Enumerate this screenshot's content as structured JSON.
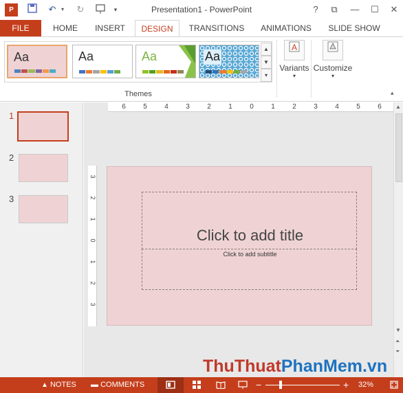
{
  "app": {
    "window_title": "Presentation1 - PowerPoint",
    "accent": "#c43e1c",
    "window_buttons": {
      "help": "?",
      "restore": "⧉",
      "minimize": "—",
      "close": "✕"
    }
  },
  "tabs": [
    "FILE",
    "HOME",
    "INSERT",
    "DESIGN",
    "TRANSITIONS",
    "ANIMATIONS",
    "SLIDE SHOW"
  ],
  "active_tab": "DESIGN",
  "ribbon": {
    "themes_group_label": "Themes",
    "theme_sample_text": "Aa",
    "themes": [
      {
        "name": "Pink",
        "bg": "#efd3d4",
        "selected": true
      },
      {
        "name": "Office",
        "bg": "#ffffff",
        "selected": false
      },
      {
        "name": "Facet",
        "bg": "#ffffff",
        "selected": false
      },
      {
        "name": "Pattern",
        "bg": "#5aa9d6",
        "selected": false
      }
    ],
    "variants_label": "Variants",
    "customize_label": "Customize"
  },
  "ruler": {
    "horizontal": [
      "6",
      "5",
      "4",
      "3",
      "2",
      "1",
      "0",
      "1",
      "2",
      "3",
      "4",
      "5",
      "6"
    ],
    "vertical": [
      "3",
      "2",
      "1",
      "0",
      "1",
      "2",
      "3"
    ]
  },
  "slides": [
    {
      "number": "1",
      "selected": true
    },
    {
      "number": "2",
      "selected": false
    },
    {
      "number": "3",
      "selected": false
    }
  ],
  "slide": {
    "background": "#efd3d4",
    "title_placeholder": "Click to add title",
    "subtitle_placeholder": "Click to add subtitle"
  },
  "statusbar": {
    "notes_label": "NOTES",
    "comments_label": "COMMENTS",
    "zoom": "32%"
  },
  "watermark": {
    "part1": "Thu",
    "part2": "Thuat",
    "part3": "PhanMem",
    "part4": ".vn"
  }
}
